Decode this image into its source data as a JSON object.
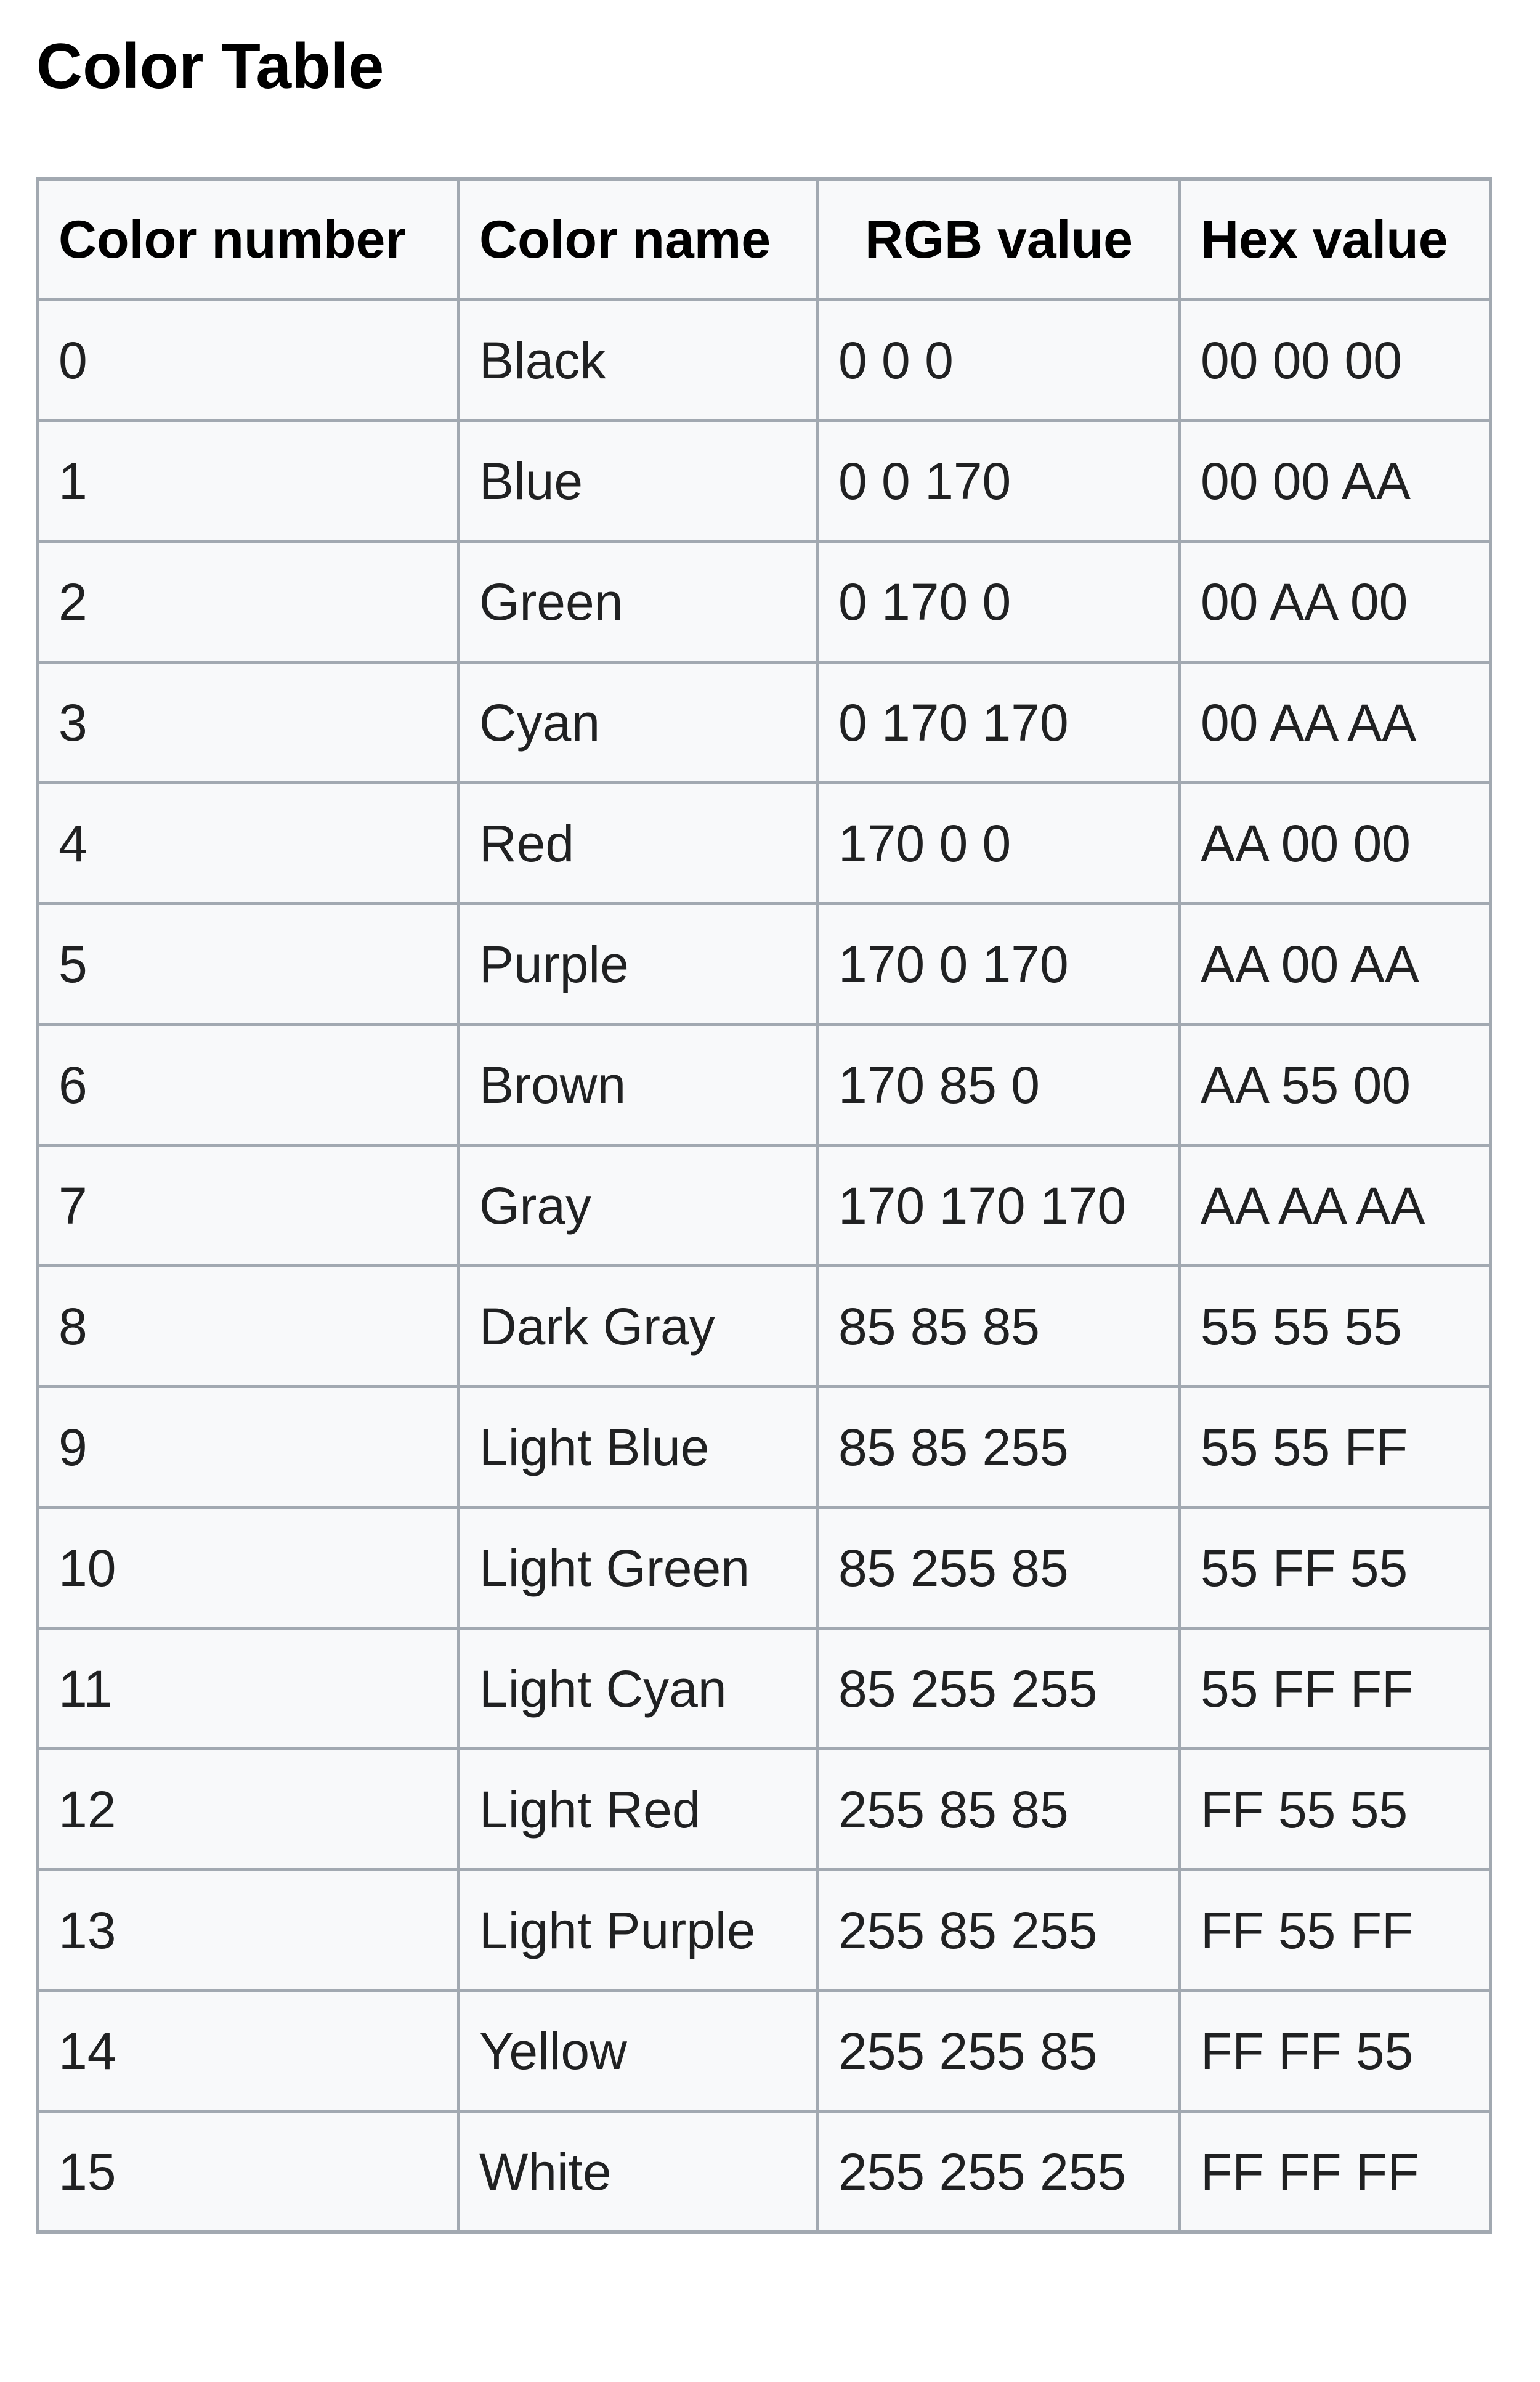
{
  "heading": "Color Table",
  "table": {
    "headers": [
      "Color number",
      "Color name",
      "RGB value",
      "Hex value"
    ],
    "rows": [
      {
        "number": "0",
        "name": "Black",
        "rgb": "0 0 0",
        "hex": "00 00 00"
      },
      {
        "number": "1",
        "name": "Blue",
        "rgb": "0 0 170",
        "hex": "00 00 AA"
      },
      {
        "number": "2",
        "name": "Green",
        "rgb": "0 170 0",
        "hex": "00 AA 00"
      },
      {
        "number": "3",
        "name": "Cyan",
        "rgb": "0 170 170",
        "hex": "00 AA AA"
      },
      {
        "number": "4",
        "name": "Red",
        "rgb": "170 0 0",
        "hex": "AA 00 00"
      },
      {
        "number": "5",
        "name": "Purple",
        "rgb": "170 0 170",
        "hex": "AA 00 AA"
      },
      {
        "number": "6",
        "name": "Brown",
        "rgb": "170 85 0",
        "hex": "AA 55 00"
      },
      {
        "number": "7",
        "name": "Gray",
        "rgb": "170 170 170",
        "hex": "AA AA AA"
      },
      {
        "number": "8",
        "name": "Dark Gray",
        "rgb": "85 85 85",
        "hex": "55 55 55"
      },
      {
        "number": "9",
        "name": "Light Blue",
        "rgb": "85 85 255",
        "hex": "55 55 FF"
      },
      {
        "number": "10",
        "name": "Light Green",
        "rgb": "85 255 85",
        "hex": "55 FF 55"
      },
      {
        "number": "11",
        "name": "Light Cyan",
        "rgb": "85 255 255",
        "hex": "55 FF FF"
      },
      {
        "number": "12",
        "name": "Light Red",
        "rgb": "255 85 85",
        "hex": "FF 55 55"
      },
      {
        "number": "13",
        "name": "Light Purple",
        "rgb": "255 85 255",
        "hex": "FF 55 FF"
      },
      {
        "number": "14",
        "name": "Yellow",
        "rgb": "255 255 85",
        "hex": "FF FF 55"
      },
      {
        "number": "15",
        "name": "White",
        "rgb": "255 255 255",
        "hex": "FF FF FF"
      }
    ]
  }
}
